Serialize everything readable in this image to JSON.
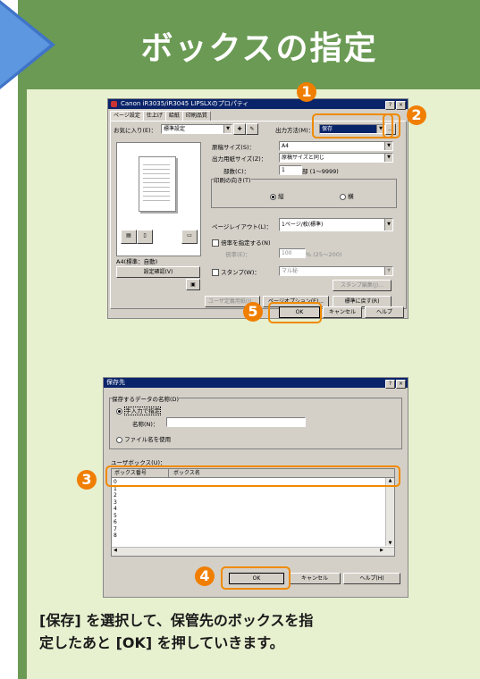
{
  "header": {
    "title": "ボックスの指定"
  },
  "dialog1": {
    "title": "Canon iR3035/iR3045 LIPSLXのプロパティ",
    "tabs": [
      "ページ設定",
      "仕上げ",
      "給紙",
      "印刷品質"
    ],
    "favorites_label": "お気に入り(E)：",
    "favorites_value": "標準設定",
    "output_method_label": "出力方法(M)：",
    "output_method_value": "保存",
    "paper_size_label": "原稿サイズ(S)：",
    "paper_size_value": "A4",
    "output_size_label": "出力用紙サイズ(Z)：",
    "output_size_value": "原稿サイズと同じ",
    "copies_label": "部数(C)：",
    "copies_value": "1",
    "copies_range": "部 (1～9999)",
    "orientation_label": "印刷の向き(T)",
    "portrait_label": "縦",
    "landscape_label": "横",
    "layout_label": "ページレイアウト(L)：",
    "layout_value": "1ページ/枚(標準)",
    "scale_checkbox_label": "倍率を指定する(N)",
    "scale_label": "倍率(E)：",
    "scale_value": "100",
    "scale_range": "% (25～200)",
    "stamp_label": "スタンプ(W)：",
    "stamp_value": "マル秘",
    "stamp_edit_button": "スタンプ編集(J)...",
    "preview_caption": "A4(標準：自動)",
    "settings_confirm_button": "設定確認(V)",
    "user_defined_button": "ユーザ定義用紙(I)...",
    "page_options_button": "ページオプション(E)...",
    "restore_button": "標準に戻す(R)",
    "ok_button": "OK",
    "cancel_button": "キャンセル",
    "help_button": "ヘルプ"
  },
  "dialog2": {
    "title": "保存先",
    "data_name_group": "保存するデータの名称(D)",
    "manual_option": "手入力で指定",
    "name_label": "名称(N)：",
    "name_value": "",
    "file_name_option": "ファイル名を使用",
    "user_box_label": "ユーザボックス(U)：",
    "col_box_number": "ボックス番号",
    "col_box_name": "ボックス名",
    "rows": [
      "0",
      "1",
      "2",
      "3",
      "4",
      "5",
      "6",
      "7",
      "8"
    ],
    "ok_button": "OK",
    "cancel_button": "キャンセル",
    "help_button": "ヘルプ(H)"
  },
  "markers": [
    "1",
    "2",
    "3",
    "4",
    "5"
  ],
  "caption": {
    "line1": "[保存] を選択して、保管先のボックスを指",
    "line2": "定したあと [OK] を押していきます。"
  },
  "colors": {
    "header_green": "#6b9a54",
    "panel_bg": "#e7f0cf",
    "arrow_blue": "#3f74c8",
    "marker_orange": "#f07e00",
    "titlebar_blue": "#0a246a"
  }
}
